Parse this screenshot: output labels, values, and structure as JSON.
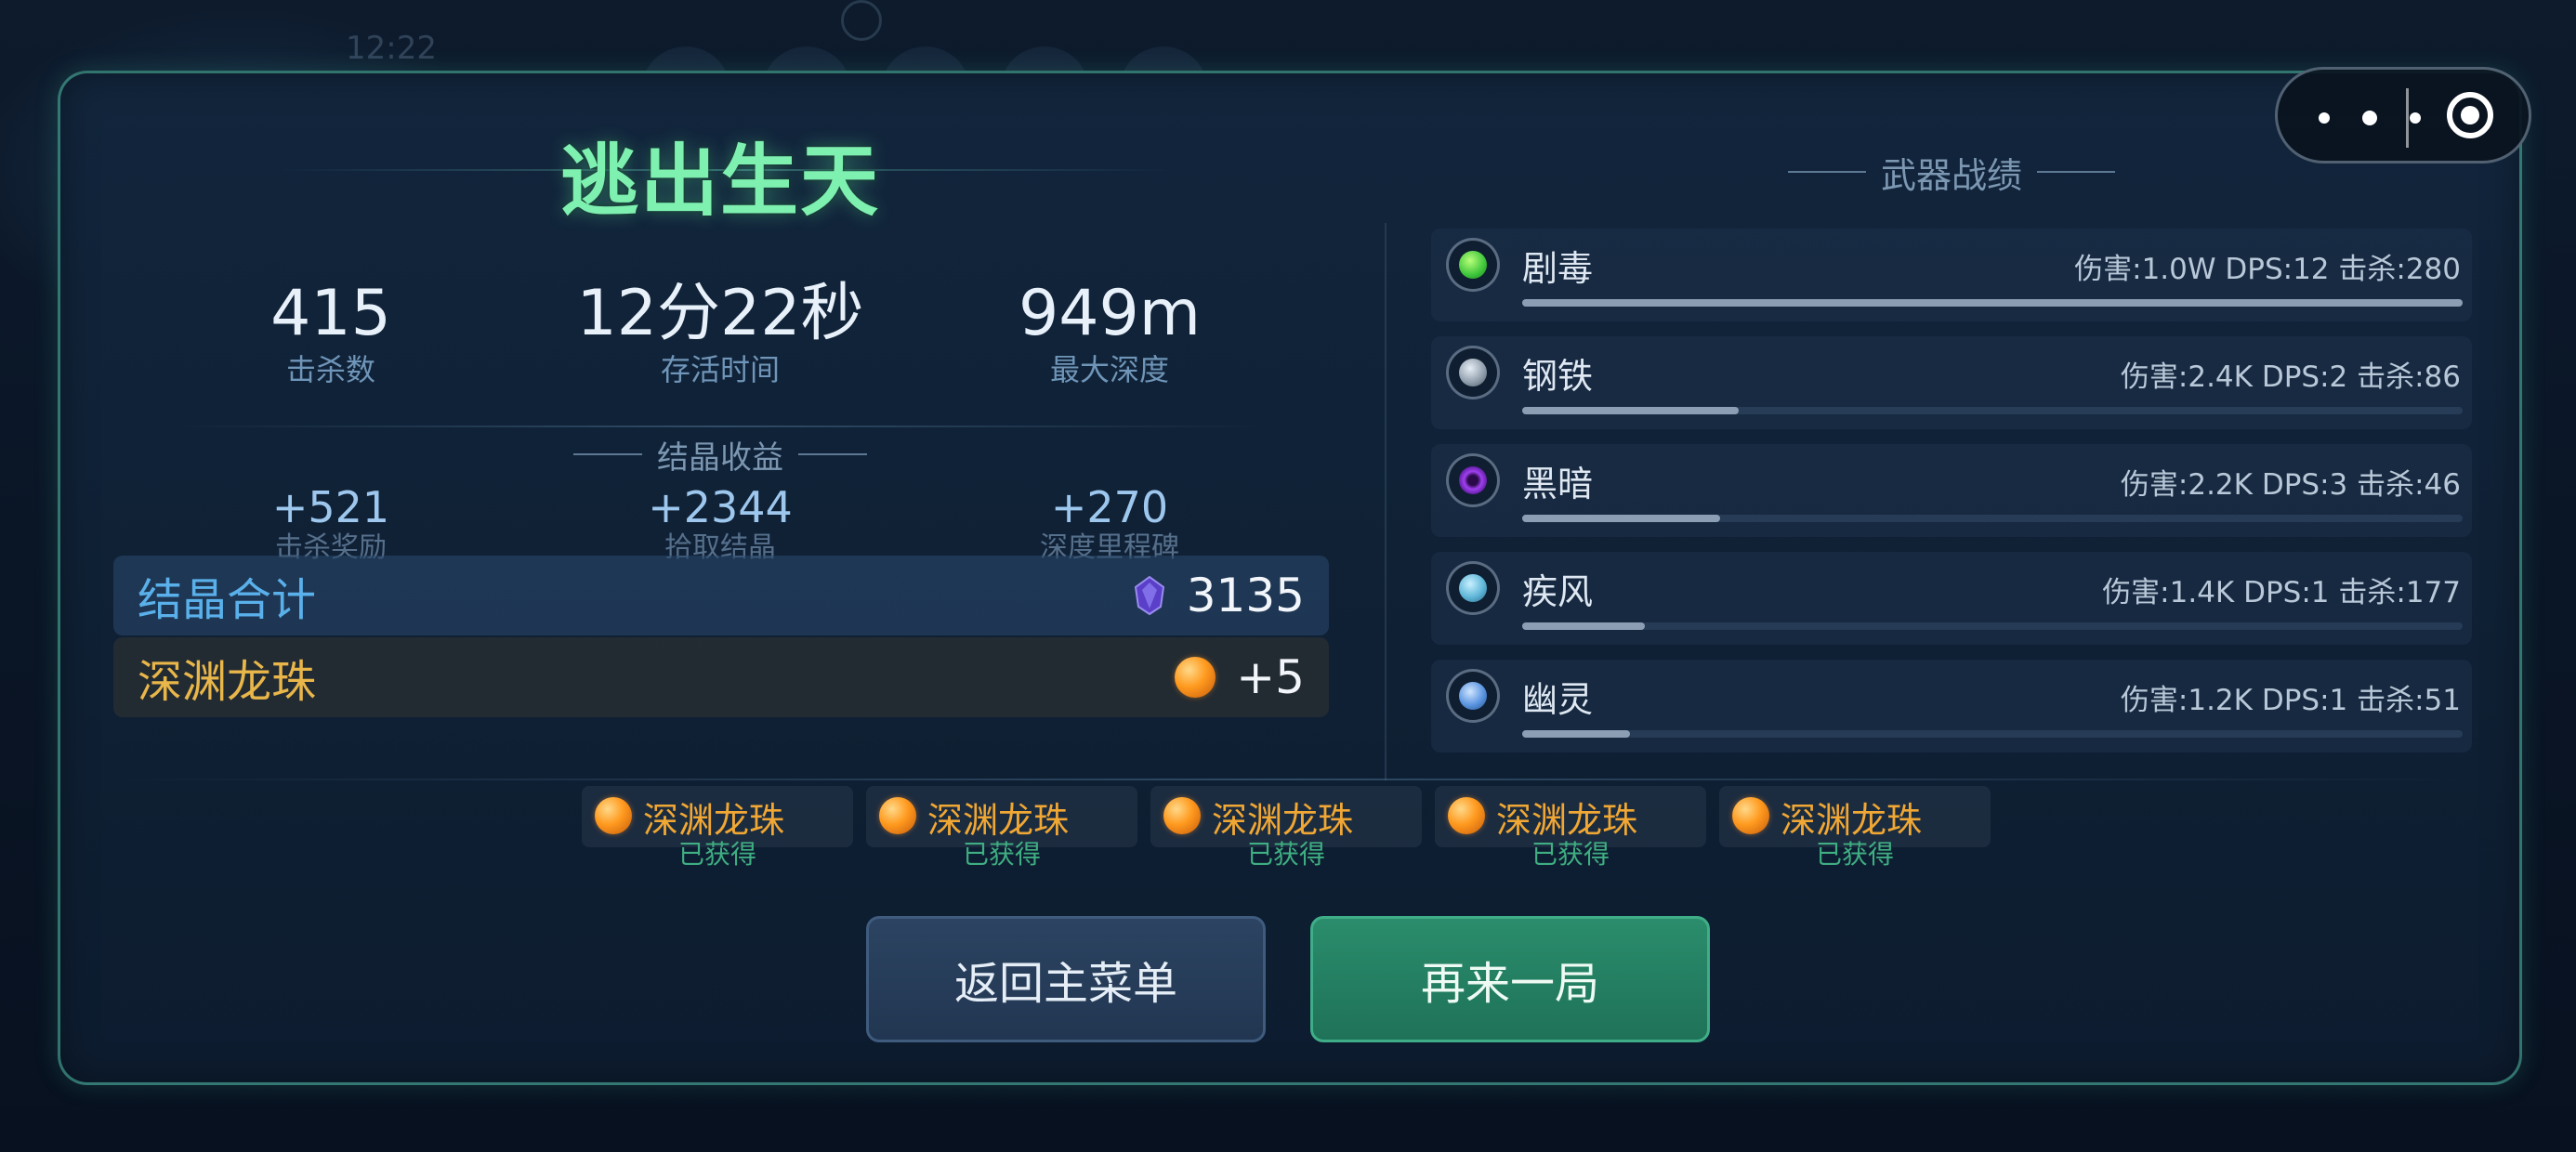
{
  "status_bar": {
    "time": "12:22"
  },
  "capsule": {
    "more_icon": "more-dots-icon",
    "close_icon": "target-circle-icon"
  },
  "result": {
    "title": "逃出生天",
    "stats": [
      {
        "value": "415",
        "label": "击杀数"
      },
      {
        "value": "12分22秒",
        "label": "存活时间"
      },
      {
        "value": "949m",
        "label": "最大深度"
      }
    ],
    "crystal_section_title": "结晶收益",
    "crystal_gains": [
      {
        "value": "+521",
        "label": "击杀奖励"
      },
      {
        "value": "+2344",
        "label": "拾取结晶"
      },
      {
        "value": "+270",
        "label": "深度里程碑"
      }
    ],
    "crystal_total": {
      "label": "结晶合计",
      "icon": "crystal-icon",
      "value": "3135",
      "color": "#5ab0ea"
    },
    "dragon_orb": {
      "label": "深渊龙珠",
      "icon": "orb-icon",
      "value": "+5",
      "color": "#e9b64a"
    }
  },
  "weapons": {
    "title": "武器战绩",
    "items": [
      {
        "name": "剧毒",
        "stats": "伤害:1.0W DPS:12 击杀:280",
        "share": 1.0,
        "icon": "poison-icon",
        "color": "#4fd04a"
      },
      {
        "name": "钢铁",
        "stats": "伤害:2.4K DPS:2 击杀:86",
        "share": 0.23,
        "icon": "steel-icon",
        "color": "#9aa8b6"
      },
      {
        "name": "黑暗",
        "stats": "伤害:2.2K DPS:3 击杀:46",
        "share": 0.21,
        "icon": "dark-icon",
        "color": "#8a3fd8"
      },
      {
        "name": "疾风",
        "stats": "伤害:1.4K DPS:1 击杀:177",
        "share": 0.13,
        "icon": "wind-icon",
        "color": "#5fb6d8"
      },
      {
        "name": "幽灵",
        "stats": "伤害:1.2K DPS:1 击杀:51",
        "share": 0.115,
        "icon": "ghost-icon",
        "color": "#5a94e0"
      }
    ]
  },
  "orbs_collected": [
    {
      "name": "深渊龙珠",
      "status": "已获得"
    },
    {
      "name": "深渊龙珠",
      "status": "已获得"
    },
    {
      "name": "深渊龙珠",
      "status": "已获得"
    },
    {
      "name": "深渊龙珠",
      "status": "已获得"
    },
    {
      "name": "深渊龙珠",
      "status": "已获得"
    }
  ],
  "buttons": {
    "menu": "返回主菜单",
    "again": "再来一局"
  },
  "colors": {
    "accent_green": "#7ef0b0",
    "button_green": "#2a8d6c",
    "button_blue": "#2c4462",
    "orb_orange": "#f0a734"
  }
}
